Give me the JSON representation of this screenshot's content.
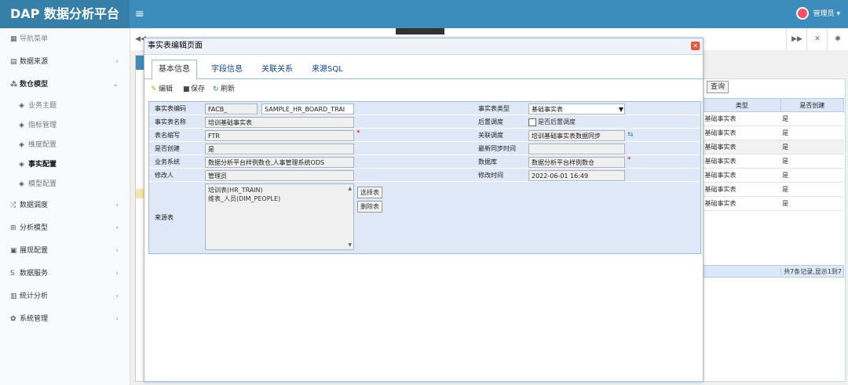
{
  "app": {
    "logo": "DAP 数据分析平台",
    "menu_toggle": "≡",
    "user": "管理员 ▾"
  },
  "sidebar": {
    "nav_title": "导航菜单",
    "items": [
      {
        "label": "数据来源",
        "icon": "database-icon",
        "chevron": "‹"
      },
      {
        "label": "数仓模型",
        "icon": "share-icon",
        "chevron": "⌄"
      },
      {
        "label": "数据调度",
        "icon": "shuffle-icon",
        "chevron": "‹"
      },
      {
        "label": "分析模型",
        "icon": "sitemap-icon",
        "chevron": "‹"
      },
      {
        "label": "展现配置",
        "icon": "layout-icon",
        "chevron": "‹"
      },
      {
        "label": "数据服务",
        "icon": "dollar-icon",
        "chevron": "‹"
      },
      {
        "label": "统计分析",
        "icon": "bar-chart-icon",
        "chevron": "‹"
      },
      {
        "label": "系统管理",
        "icon": "gear-icon",
        "chevron": "‹"
      }
    ],
    "subitems": [
      "业务主题",
      "指标管理",
      "维度配置",
      "事实配置",
      "模型配置"
    ],
    "active_sub": "事实配置"
  },
  "background": {
    "query_button": "查询",
    "grid_headers": [
      "类型",
      "是否创建"
    ],
    "grid_rows": [
      [
        "基础事实表",
        "是"
      ],
      [
        "基础事实表",
        "是"
      ],
      [
        "基础事实表",
        "是"
      ],
      [
        "基础事实表",
        "是"
      ],
      [
        "基础事实表",
        "是"
      ],
      [
        "基础事实表",
        "是"
      ],
      [
        "基础事实表",
        "是"
      ]
    ],
    "footer": "共7条记录,显示1到7"
  },
  "modal": {
    "title": "事实表编辑页面",
    "tabs": [
      "基本信息",
      "字段信息",
      "关联关系",
      "来源SQL"
    ],
    "toolbar": {
      "edit": "编辑",
      "save": "保存",
      "refresh": "刷新"
    },
    "labels": {
      "code": "事实表编码",
      "name": "事实表名称",
      "abbr": "表名缩写",
      "created": "是否创建",
      "system": "业务系统",
      "modifier": "修改人",
      "source": "来源表",
      "type": "事实表类型",
      "post_sched": "后置调度",
      "rel_sched": "关联调度",
      "last_sync": "最新同步时间",
      "db": "数据库",
      "mod_time": "修改时间"
    },
    "values": {
      "code_prefix": "FACB_",
      "code_suffix": "SAMPLE_HR_BOARD_TRAI",
      "name": "培训基础事实表",
      "abbr": "FTR",
      "created": "是",
      "system": "数据分析平台样例数仓,人事管理系统ODS",
      "modifier": "管理员",
      "type": "基础事实表",
      "post_sched_check": "是否后置调度",
      "rel_sched": "培训基础事实表数据同步",
      "last_sync": "",
      "db": "数据分析平台样例数仓",
      "mod_time": "2022-06-01 16:49"
    },
    "source_tables": [
      "培训表(HR_TRAIN)",
      "维表_人员(DIM_PEOPLE)"
    ],
    "buttons": {
      "select": "选择表",
      "remove": "删除表"
    }
  }
}
